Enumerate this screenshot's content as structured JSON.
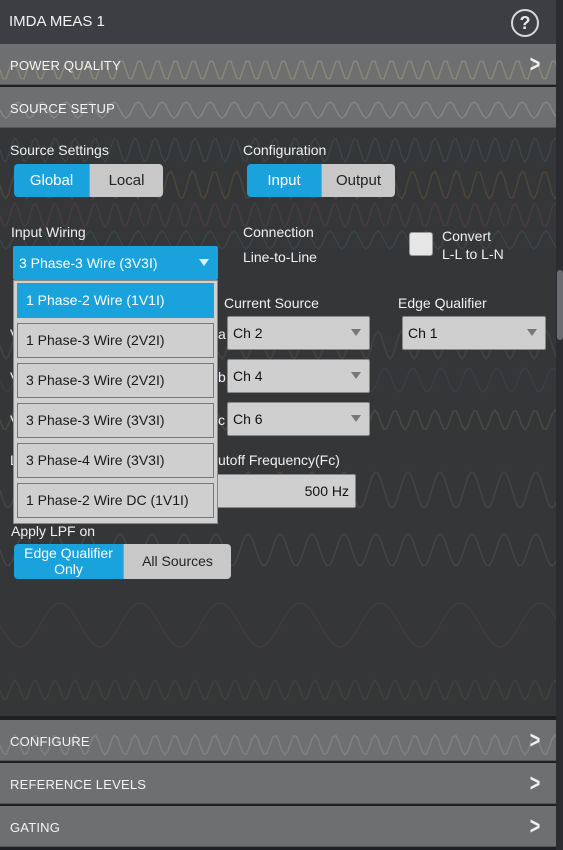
{
  "window": {
    "title": "IMDA MEAS 1",
    "help_icon": "question-circle-icon"
  },
  "sections": {
    "power_quality": "POWER QUALITY",
    "source_setup": "SOURCE SETUP",
    "configure": "CONFIGURE",
    "reference_levels": "REFERENCE LEVELS",
    "gating": "GATING"
  },
  "source_settings": {
    "label": "Source Settings",
    "options": [
      "Global",
      "Local"
    ],
    "selected": "Global"
  },
  "configuration": {
    "label": "Configuration",
    "options": [
      "Input",
      "Output"
    ],
    "selected": "Input"
  },
  "input_wiring": {
    "label": "Input Wiring",
    "value": "3 Phase-3 Wire (3V3I)",
    "options": [
      "1 Phase-2 Wire (1V1I)",
      "1 Phase-3 Wire (2V2I)",
      "3 Phase-3 Wire (2V2I)",
      "3 Phase-3 Wire (3V3I)",
      "3 Phase-4 Wire (3V3I)",
      "1 Phase-2 Wire DC (1V1I)"
    ],
    "highlighted": "1 Phase-2 Wire (1V1I)"
  },
  "connection": {
    "label": "Connection",
    "value": "Line-to-Line"
  },
  "convert": {
    "label_line1": "Convert",
    "label_line2": "L-L to L-N",
    "checked": false
  },
  "sources": {
    "current_source_label": "Current Source",
    "edge_qualifier_label": "Edge Qualifier",
    "current": [
      "Ch 2",
      "Ch 4",
      "Ch 6"
    ],
    "edge_qualifier": "Ch 1",
    "partial_row_chars": [
      "V",
      "V",
      "V"
    ],
    "partial_col_chars": [
      "a",
      "b",
      "c"
    ]
  },
  "lpf": {
    "partial_label_char": "L",
    "cutoff_label": "utoff Frequency(Fc)",
    "cutoff_value": "500 Hz",
    "apply_label": "Apply LPF on",
    "options": [
      "Edge Qualifier Only",
      "All Sources"
    ],
    "option_0_line1": "Edge Qualifier",
    "option_0_line2": "Only",
    "selected": "Edge Qualifier Only"
  },
  "colors": {
    "accent": "#1aa2dd",
    "button_off": "#c8c8c8",
    "title_bg": "#3c3e43"
  }
}
